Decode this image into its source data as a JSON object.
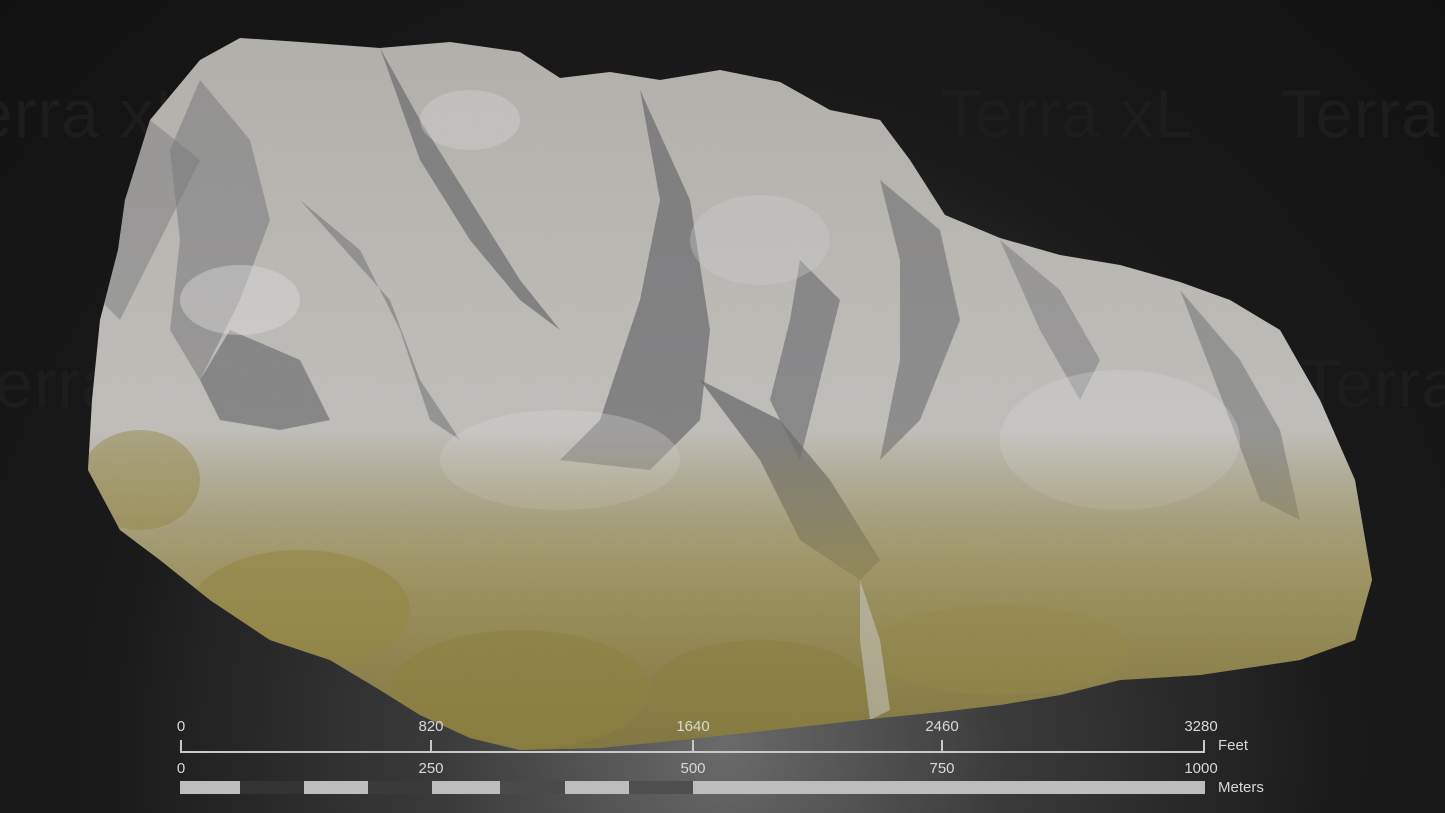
{
  "watermark": {
    "text": "Terra xL"
  },
  "scale_bar": {
    "feet": {
      "unit": "Feet",
      "ticks": [
        "0",
        "820",
        "1640",
        "2460",
        "3280"
      ]
    },
    "meters": {
      "unit": "Meters",
      "ticks": [
        "0",
        "250",
        "500",
        "750",
        "1000"
      ]
    }
  },
  "colors": {
    "background": "#141414",
    "rock": "#b7b4ad",
    "shadow": "#5a5a5c",
    "moss": "#8a7a2a",
    "scale_light": "#c0c0c0",
    "scale_dark": "#3a3a3a"
  }
}
